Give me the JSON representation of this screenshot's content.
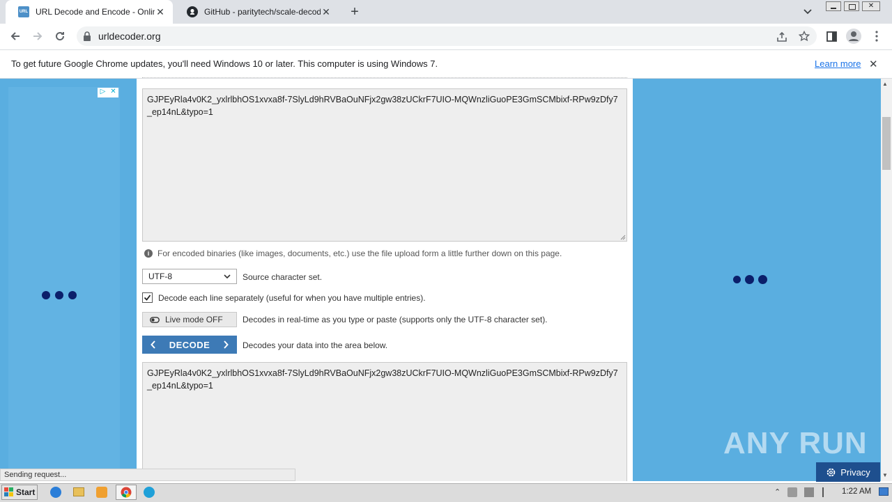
{
  "browser": {
    "tabs": [
      {
        "title": "URL Decode and Encode - Online",
        "favicon": "urldecoder-favicon",
        "active": true
      },
      {
        "title": "GitHub - paritytech/scale-decode: De",
        "favicon": "github-icon",
        "active": false
      }
    ],
    "new_tab_label": "+",
    "url": "urldecoder.org"
  },
  "infobar": {
    "message": "To get future Google Chrome updates, you'll need Windows 10 or later. This computer is using Windows 7.",
    "link": "Learn more"
  },
  "page": {
    "input_text": "GJPEyRla4v0K2_yxlrlbhOS1xvxa8f-7SlyLd9hRVBaOuNFjx2gw38zUCkrF7UIO-MQWnzliGuoPE3GmSCMbixf-RPw9zDfy7_ep14nL&typo=1",
    "binary_note": "For encoded binaries (like images, documents, etc.) use the file upload form a little further down on this page.",
    "charset": {
      "selected": "UTF-8",
      "label": "Source character set."
    },
    "decode_each_line": {
      "checked": true,
      "label": "Decode each line separately (useful for when you have multiple entries)."
    },
    "live_mode": {
      "button": "Live mode OFF",
      "label": "Decodes in real-time as you type or paste (supports only the UTF-8 character set)."
    },
    "decode": {
      "button": "DECODE",
      "label": "Decodes your data into the area below."
    },
    "output_text": "GJPEyRla4v0K2_yxlrlbhOS1xvxa8f-7SlyLd9hRVBaOuNFjx2gw38zUCkrF7UIO-MQWnzliGuoPE3GmSCMbixf-RPw9zDfy7_ep14nL&typo=1"
  },
  "status": "Sending request...",
  "privacy": "Privacy",
  "watermark": "ANY RUN",
  "taskbar": {
    "start": "Start",
    "clock": "1:22 AM"
  },
  "colors": {
    "accent": "#3d7ab6",
    "ad_bg": "#5aaee0",
    "link": "#1a73e8"
  }
}
